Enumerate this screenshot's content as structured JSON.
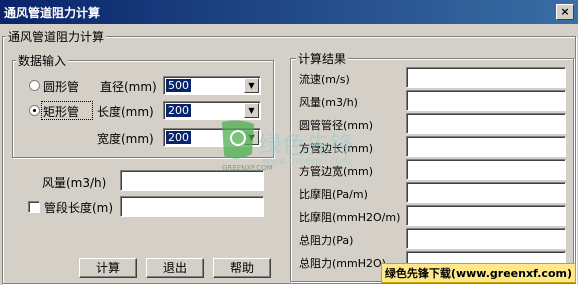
{
  "window": {
    "title": "通风管道阻力计算",
    "close_label": "×"
  },
  "main_group": {
    "title": "通风管道阻力计算"
  },
  "input_group": {
    "title": "数据输入",
    "round_pipe_label": "圆形管",
    "rect_pipe_label": "矩形管",
    "diameter_label": "直径(mm)",
    "diameter_value": "500",
    "length_label": "长度(mm)",
    "length_value": "200",
    "width_label": "宽度(mm)",
    "width_value": "200",
    "selected_shape": "矩形管"
  },
  "airflow_label": "风量(m3/h)",
  "airflow_value": "",
  "segment_length_label": "管段长度(m)",
  "segment_length_value": "",
  "results_group": {
    "title": "计算结果",
    "items": [
      {
        "label": "流速(m/s)",
        "value": ""
      },
      {
        "label": "风量(m3/h)",
        "value": ""
      },
      {
        "label": "圆管管径(mm)",
        "value": ""
      },
      {
        "label": "方管边长(mm)",
        "value": ""
      },
      {
        "label": "方管边宽(mm)",
        "value": ""
      },
      {
        "label": "比摩阻(Pa/m)",
        "value": ""
      },
      {
        "label": "比摩阻(mmH2O/m)",
        "value": ""
      },
      {
        "label": "总阻力(Pa)",
        "value": ""
      },
      {
        "label": "总阻力(mmH2O)",
        "value": ""
      }
    ]
  },
  "buttons": {
    "calculate": "计算",
    "exit": "退出",
    "help": "帮助"
  },
  "watermark": {
    "site_text": "绿色先锋",
    "url": "www.greenxf.com",
    "logo_text": "GREENXF.COM"
  },
  "banner": {
    "text": "绿色先锋下载(www.greenxf.com)"
  },
  "colors": {
    "titlebar": "#0a246a",
    "selection": "#0a246a",
    "dialog_bg": "#d4d0c8"
  }
}
